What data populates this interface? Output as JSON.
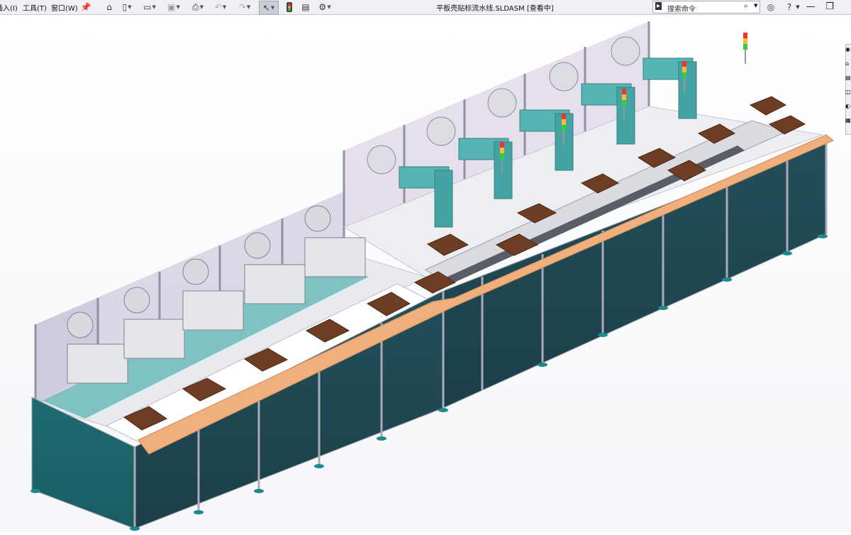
{
  "menu": {
    "insert": "插入(I)",
    "tools": "工具(T)",
    "window": "窗口(W)"
  },
  "document": {
    "title": "平板壳贴标流水线.SLDASM [查看中]"
  },
  "search": {
    "placeholder": "搜索命令"
  },
  "colors": {
    "cabinet": "#1f6e74",
    "cabinet_dark": "#1b4f58",
    "belt": "#f0b07e",
    "tray": "#6d3e24",
    "module": "#55b4b4",
    "frame": "#b5b7c2"
  }
}
